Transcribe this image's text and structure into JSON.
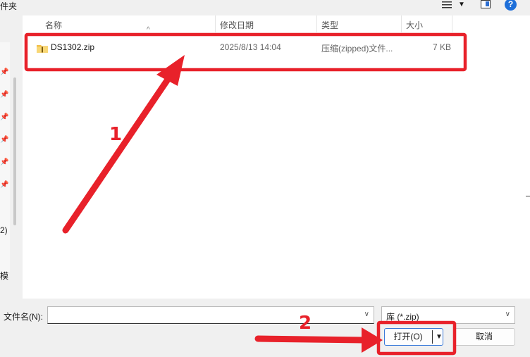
{
  "top": {
    "left_fragment": "件夹"
  },
  "icons": {
    "view_icon": "view-list-icon",
    "pane_icon": "preview-pane-icon",
    "help_icon": "help-icon",
    "help_glyph": "?"
  },
  "left_nav": {
    "fragments": [
      "2)",
      "模"
    ]
  },
  "columns": {
    "name": "名称",
    "modified": "修改日期",
    "type": "类型",
    "size": "大小"
  },
  "files": [
    {
      "name": "DS1302.zip",
      "modified": "2025/8/13 14:04",
      "type": "压缩(zipped)文件...",
      "size": "7 KB"
    }
  ],
  "bottom": {
    "filename_label": "文件名(N):",
    "filename_value": "",
    "filter_value": "库 (*.zip)",
    "open_label": "打开(O)",
    "cancel_label": "取消"
  },
  "annotations": {
    "step1": "1",
    "step2": "2",
    "color": "#e8212a"
  }
}
